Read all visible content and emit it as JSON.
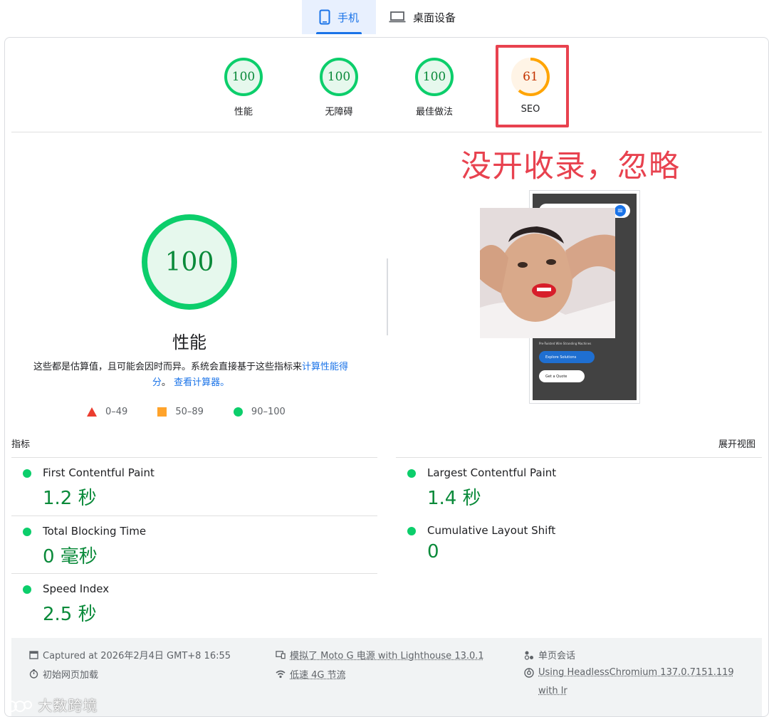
{
  "tabs": {
    "mobile": "手机",
    "desktop": "桌面设备"
  },
  "gauges": [
    {
      "score": "100",
      "label": "性能",
      "color": "#0cce6b"
    },
    {
      "score": "100",
      "label": "无障碍",
      "color": "#0cce6b"
    },
    {
      "score": "100",
      "label": "最佳做法",
      "color": "#0cce6b"
    },
    {
      "score": "61",
      "label": "SEO",
      "color": "#ffa400",
      "fraction": 0.61
    }
  ],
  "annotation": "没开收录，忽略",
  "performance": {
    "score": "100",
    "title": "性能",
    "desc_prefix": "这些都是估算值，且可能会因时而异。系统会直接基于这些指标来",
    "desc_link1": "计算性能得分",
    "desc_mid": "。",
    "desc_link2": "查看计算器。"
  },
  "legend": {
    "fail": "0–49",
    "average": "50–89",
    "pass": "90–100"
  },
  "screenshot": {
    "explore": "Explore Solutions",
    "quote": "Get a Quote",
    "line": "Pre-Twisted Wire Stranding Machines"
  },
  "metrics": {
    "header": "指标",
    "expand": "展开视图",
    "items": [
      {
        "name": "First Contentful Paint",
        "value": "1.2 秒"
      },
      {
        "name": "Largest Contentful Paint",
        "value": "1.4 秒"
      },
      {
        "name": "Total Blocking Time",
        "value": "0 毫秒"
      },
      {
        "name": "Cumulative Layout Shift",
        "value": "0"
      },
      {
        "name": "Speed Index",
        "value": "2.5 秒"
      }
    ]
  },
  "footer": {
    "captured": "Captured at 2026年2月4日 GMT+8 16:55",
    "initial_load": "初始网页加载",
    "emulated": "模拟了 Moto G 电源 with Lighthouse 13.0.1",
    "throttling": "低速 4G 节流",
    "session": "单页会话",
    "browser_line1": "Using HeadlessChromium 137.0.7151.119",
    "browser_line2": "with lr"
  },
  "watermark": "大数跨境"
}
